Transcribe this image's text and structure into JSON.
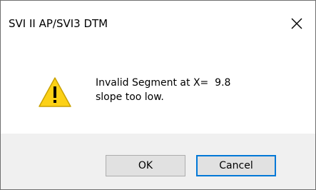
{
  "window": {
    "title": "SVI II AP/SVI3 DTM"
  },
  "message": {
    "line1": "Invalid Segment at X=  9.8",
    "line2": "slope too low."
  },
  "buttons": {
    "ok_label": "OK",
    "cancel_label": "Cancel"
  },
  "icons": {
    "close": "close-icon",
    "warning": "warning-icon"
  },
  "colors": {
    "warning_fill": "#fcd116",
    "focus_border": "#0078d7",
    "footer_bg": "#f0f0f0",
    "button_bg": "#e1e1e1"
  }
}
